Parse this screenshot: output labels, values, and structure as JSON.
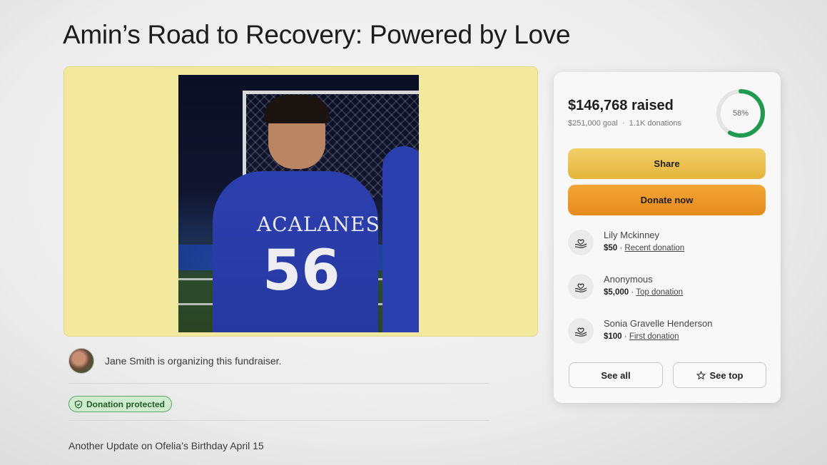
{
  "page": {
    "title": "Amin’s Road to Recovery: Powered by Love"
  },
  "media": {
    "photo_alt": "ACALANES",
    "jersey_text": "ACALANES",
    "jersey_number": "56"
  },
  "organizer": {
    "text": "Jane Smith is organizing this fundraiser."
  },
  "badge": {
    "label": "Donation protected",
    "icon": "shield-check-icon"
  },
  "update": {
    "text": "Another Update on Ofelia’s Birthday April 15"
  },
  "donation_card": {
    "raised": "$146,768 raised",
    "goal": "$251,000 goal",
    "separator": "·",
    "donations_count": "1.1K donations",
    "progress_label": "58%",
    "progress_fraction": 0.58,
    "share_label": "Share",
    "donate_label": "Donate now",
    "donors": [
      {
        "name": "Lily Mckinney",
        "amount": "$50",
        "tag": "Recent donation"
      },
      {
        "name": "Anonymous",
        "amount": "$5,000",
        "tag": "Top donation"
      },
      {
        "name": "Sonia Gravelle Henderson",
        "amount": "$100",
        "tag": "First donation"
      }
    ],
    "see_all_label": "See all",
    "see_top_label": "See top"
  },
  "colors": {
    "media_bg": "#f3e99e",
    "progress_ring": "#1f9a4e",
    "share_button": "#e9bf4d",
    "donate_button": "#ec9a2b",
    "badge_bg": "#cfeccd"
  }
}
